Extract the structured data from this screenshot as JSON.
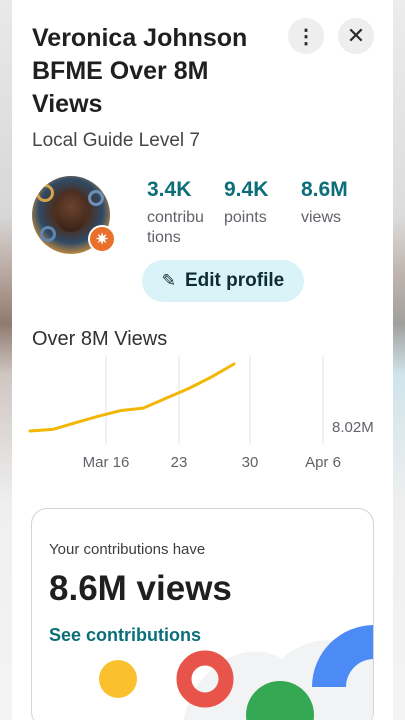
{
  "profile": {
    "name": "Veronica Johnson BFME Over 8M Views",
    "level": "Local Guide Level 7",
    "stats": [
      {
        "value": "3.4K",
        "label": "contribu tions"
      },
      {
        "value": "9.4K",
        "label": "points"
      },
      {
        "value": "8.6M",
        "label": "views"
      }
    ],
    "edit_label": "Edit profile"
  },
  "icons": {
    "more": "more-vertical-icon",
    "close": "close-icon",
    "edit": "pencil-icon",
    "badge": "local-guide-star-icon"
  },
  "section_title": "Over 8M Views",
  "chart_data": {
    "type": "line",
    "x_ticks": [
      "Mar 16",
      "23",
      "30",
      "Apr 6"
    ],
    "value_label": "8.02M",
    "series": [
      {
        "color": "#f2b705",
        "points": [
          [
            0,
            7.2
          ],
          [
            1,
            7.22
          ],
          [
            2,
            7.3
          ],
          [
            3,
            7.38
          ],
          [
            4,
            7.45
          ],
          [
            5,
            7.48
          ],
          [
            6,
            7.6
          ],
          [
            7,
            7.72
          ],
          [
            8,
            7.86
          ],
          [
            9,
            8.02
          ]
        ]
      }
    ],
    "grid": true
  },
  "card": {
    "intro": "Your contributions have",
    "big": "8.6M views",
    "link": "See contributions"
  },
  "colors": {
    "accent": "#0b6e78",
    "edit_bg": "#d9f3f8",
    "badge": "#e8702a",
    "line": "#f2b705"
  }
}
